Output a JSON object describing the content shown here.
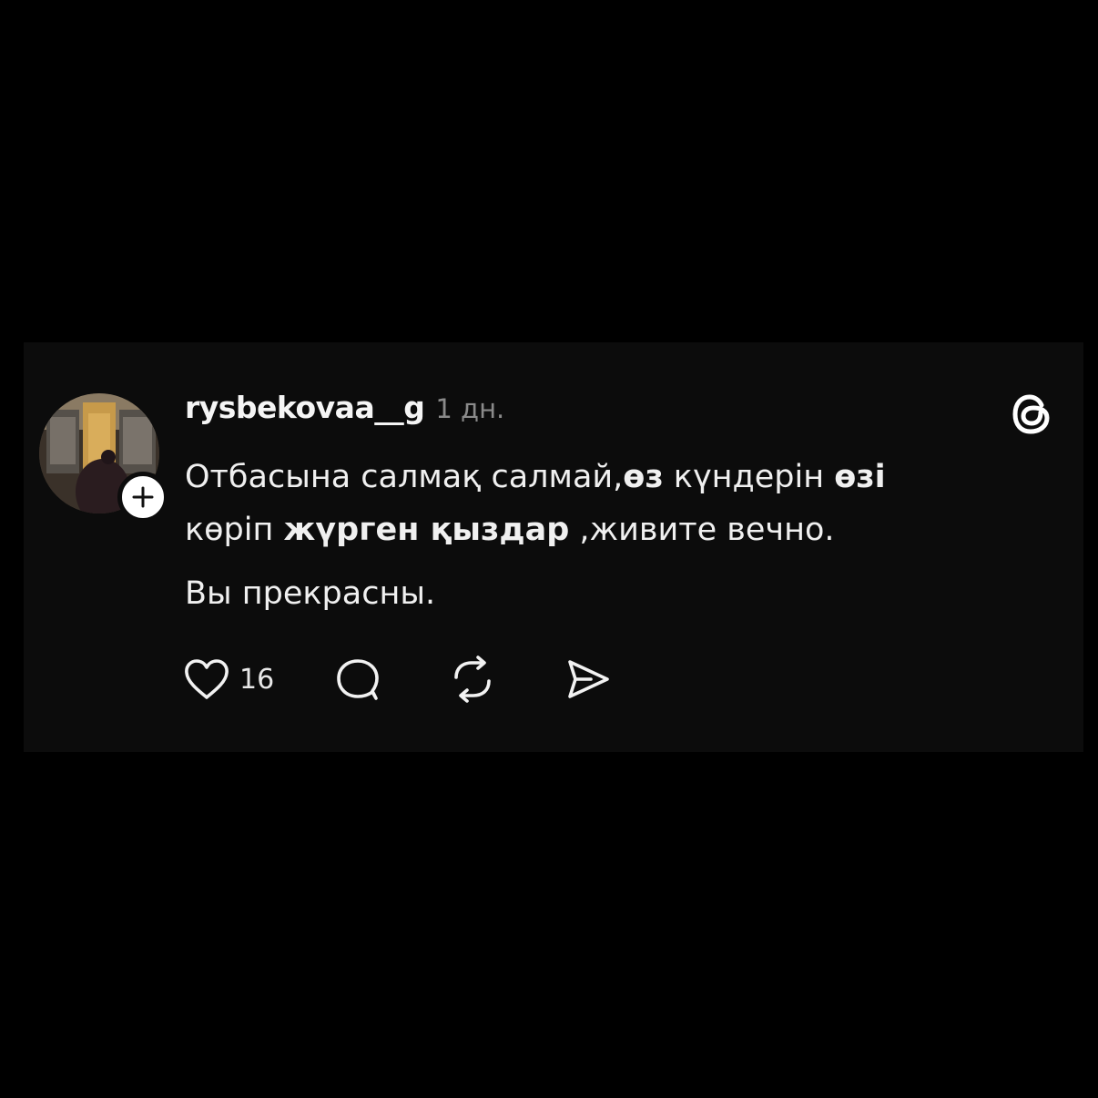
{
  "post": {
    "username": "rysbekovaa__g",
    "timestamp": "1 дн.",
    "text": {
      "line1": {
        "part1": "Отбасына салмақ салмай,",
        "bold1": "өз",
        "part2": " күндерін ",
        "bold2": "өзі"
      },
      "line2": {
        "part1": "көріп ",
        "bold1": "жүрген қыздар",
        "part2": " ,живите вечно."
      },
      "line3": "Вы прекрасны."
    },
    "likes": "16"
  },
  "icons": {
    "follow": "plus-icon",
    "app_logo": "threads-logo-icon",
    "like": "heart-icon",
    "reply": "comment-bubble-icon",
    "repost": "repost-icon",
    "share": "send-icon"
  },
  "colors": {
    "background": "#000000",
    "card": "#0c0c0c",
    "text": "#f0f0f0",
    "muted": "#8a8a8a"
  }
}
